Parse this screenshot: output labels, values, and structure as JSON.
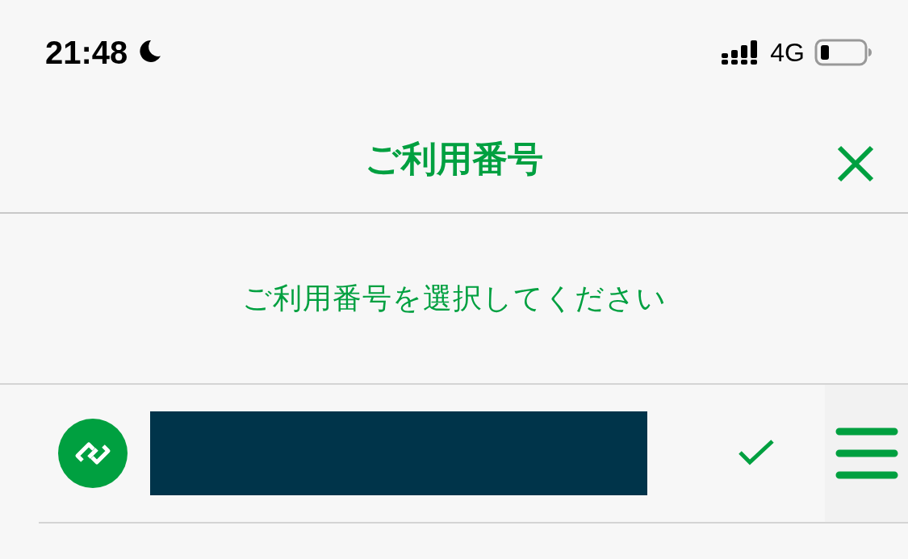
{
  "status_bar": {
    "time": "21:48",
    "network": "4G"
  },
  "header": {
    "title": "ご利用番号"
  },
  "prompt": "ご利用番号を選択してください",
  "numbers": [
    {
      "kind": "linked",
      "selected": true
    }
  ]
}
